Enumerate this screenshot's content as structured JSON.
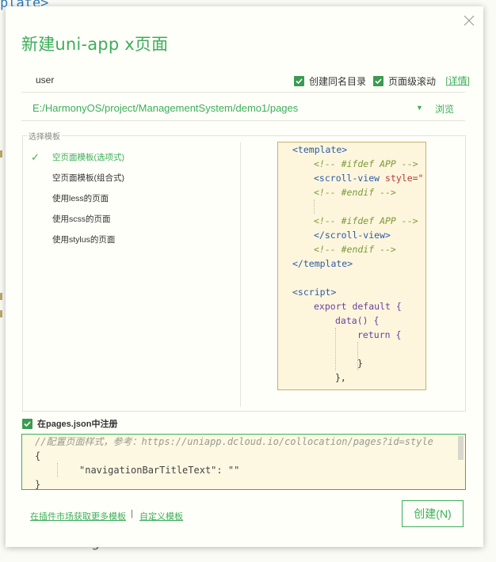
{
  "background": {
    "top_code": "plate>",
    "bottom_text": "g"
  },
  "dialog": {
    "title": "新建uni-app x页面",
    "close_icon": "close-icon"
  },
  "name_row": {
    "value": "user",
    "checkbox_same_dir": {
      "label": "创建同名目录",
      "checked": true
    },
    "checkbox_page_scroll": {
      "label": "页面级滚动",
      "checked": true
    },
    "detail_link": "[详情]"
  },
  "path_row": {
    "path": "E:/HarmonyOS/project/ManagementSystem/demo1/pages",
    "browse_label": "浏览"
  },
  "templates": {
    "legend": "选择模板",
    "items": [
      {
        "label": "空页面模板(选项式)",
        "selected": true
      },
      {
        "label": "空页面模板(组合式)",
        "selected": false
      },
      {
        "label": "使用less的页面",
        "selected": false
      },
      {
        "label": "使用scss的页面",
        "selected": false
      },
      {
        "label": "使用stylus的页面",
        "selected": false
      }
    ]
  },
  "preview": {
    "l1": "<template>",
    "l2": "<!-- #ifdef APP -->",
    "l3_tag": "<scroll-view",
    "l3_attr": " style=\"",
    "l4": "<!-- #endif -->",
    "l5": "<!-- #ifdef APP -->",
    "l6": "</scroll-view>",
    "l7": "<!-- #endif -->",
    "l8": "</template>",
    "l9": "<script>",
    "l10": "export default {",
    "l11": "data() {",
    "l12": "return {",
    "l13": "}",
    "l14": "},"
  },
  "register": {
    "label": "在pages.json中注册",
    "checked": true,
    "json_comment": "//配置页面样式，参考：https://uniapp.dcloud.io/collocation/pages?id=style",
    "json_open": "{",
    "json_entry": "\"navigationBarTitleText\": \"\"",
    "json_close": "}"
  },
  "footer": {
    "plugin_link": "在插件市场获取更多模板",
    "separator": "|",
    "custom_link": "自定义模板",
    "create_button": "创建(N)"
  },
  "colors": {
    "accent": "#3cae5a",
    "checkbox": "#3c9a52",
    "preview_bg": "#fdf6dc"
  }
}
